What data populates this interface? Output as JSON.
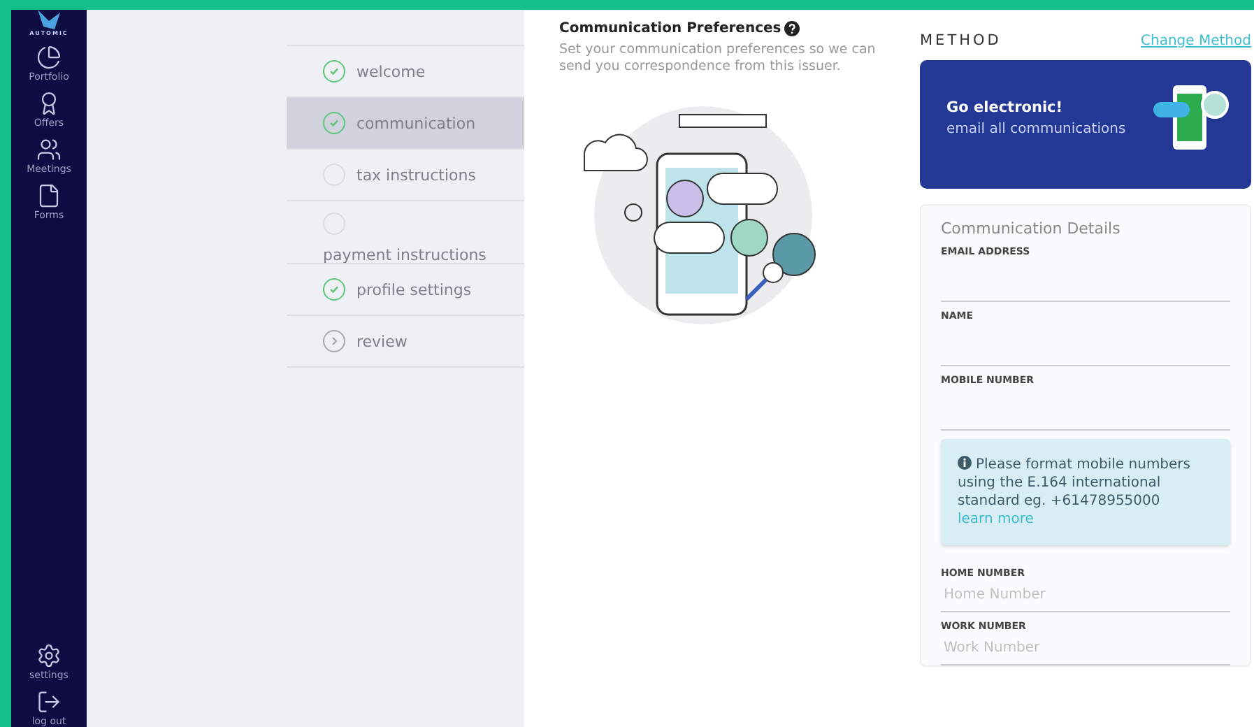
{
  "sidebar": {
    "logo_text": "AUTOMIC",
    "items": [
      {
        "label": "Portfolio"
      },
      {
        "label": "Offers"
      },
      {
        "label": "Meetings"
      },
      {
        "label": "Forms"
      }
    ],
    "bottom_items": [
      {
        "label": "settings"
      },
      {
        "label": "log out"
      }
    ]
  },
  "steps": [
    {
      "kind": "check",
      "label": "welcome",
      "completed": true,
      "selected": false
    },
    {
      "kind": "check",
      "label": "communication",
      "completed": true,
      "selected": true
    },
    {
      "kind": "check",
      "label": "tax instructions",
      "completed": false,
      "selected": false
    },
    {
      "kind": "check",
      "label": "payment instructions",
      "completed": false,
      "selected": false,
      "wrapped": true
    },
    {
      "kind": "check",
      "label": "profile settings",
      "completed": true,
      "selected": false
    },
    {
      "kind": "arrow",
      "label": "review",
      "selected": false
    }
  ],
  "preferences": {
    "title": "Communication Preferences",
    "description": "Set your communication preferences so we can send you correspondence from this issuer."
  },
  "method": {
    "heading": "METHOD",
    "change_link": "Change Method",
    "card_title": "Go electronic!",
    "card_subtitle": "email all communications"
  },
  "details": {
    "title": "Communication Details",
    "fields": [
      {
        "kind": "input",
        "label": "EMAIL ADDRESS"
      },
      {
        "kind": "input",
        "label": "NAME"
      },
      {
        "kind": "input",
        "label": "MOBILE NUMBER"
      },
      {
        "kind": "notice",
        "text": "Please format mobile numbers using the E.164 international standard eg. +61478955000",
        "link": "learn more"
      },
      {
        "kind": "input",
        "label": "HOME NUMBER",
        "placeholder": "Home Number"
      },
      {
        "kind": "input",
        "label": "WORK NUMBER",
        "placeholder": "Work Number"
      }
    ]
  }
}
